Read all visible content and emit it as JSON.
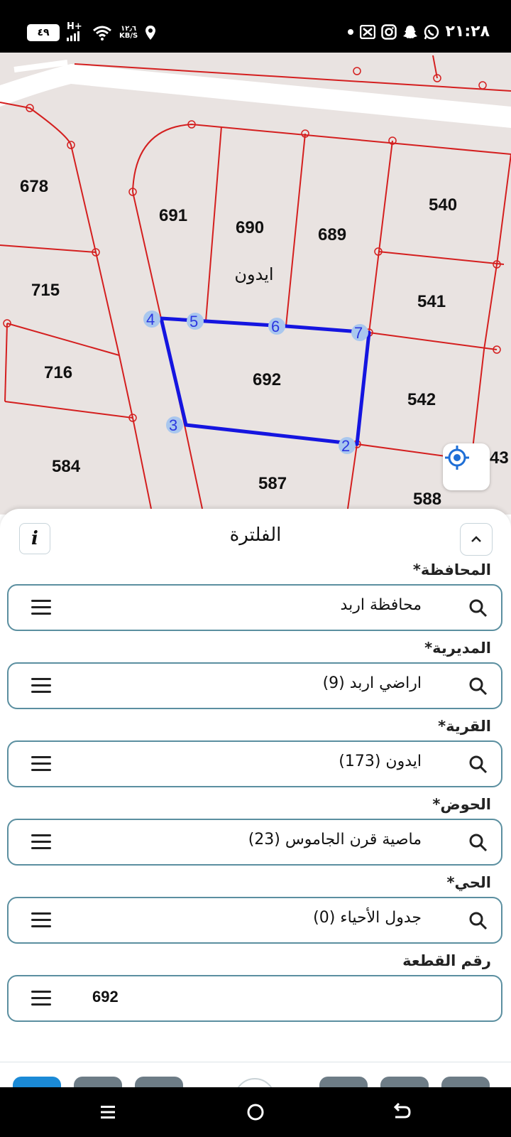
{
  "status_bar": {
    "battery": "٤٩",
    "network": "H+",
    "data_rate_value": "١٢٫٦",
    "data_rate_unit": "KB/S",
    "time": "٢١:٢٨",
    "icons": [
      "signal-icon",
      "wifi-icon",
      "location-icon",
      "dot-icon",
      "x-icon",
      "instagram-icon",
      "snapchat-icon",
      "whatsapp-icon"
    ]
  },
  "map": {
    "parcels": [
      "678",
      "691",
      "690",
      "689",
      "540",
      "715",
      "541",
      "716",
      "692",
      "542",
      "584",
      "587",
      "588",
      "43"
    ],
    "village_label": "ايدون",
    "vertex_labels": [
      "4",
      "5",
      "6",
      "7",
      "3",
      "2"
    ],
    "colors": {
      "boundary": "#d41f1f",
      "selection": "#1515e0",
      "background": "#e9e3e1"
    }
  },
  "filter": {
    "title": "الفلترة",
    "fields": [
      {
        "label": "المحافظة*",
        "value": "محافظة اربد"
      },
      {
        "label": "المديرية*",
        "value": "اراضي اربد (9)"
      },
      {
        "label": "القرية*",
        "value": "ايدون (173)"
      },
      {
        "label": "الحوض*",
        "value": "ماصية قرن الجاموس (23)"
      },
      {
        "label": "الحي*",
        "value": "جدول الأحياء (0)"
      }
    ],
    "parcel_label": "رقم القطعة",
    "parcel_value": "692"
  }
}
